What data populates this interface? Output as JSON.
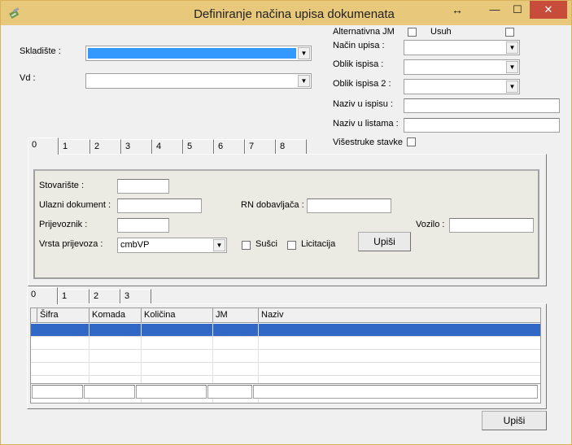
{
  "window": {
    "title": "Definiranje načina upisa dokumenata",
    "resize_glyph": "↔",
    "min_glyph": "—",
    "max_glyph": "☐",
    "close_glyph": "✕"
  },
  "form": {
    "skladiste_label": "Skladište :",
    "vd_label": "Vd :",
    "alternativna_jm_label": "Alternativna JM",
    "usuh_label": "Usuh",
    "nacin_upisa_label": "Način upisa :",
    "oblik_ispisa_label": "Oblik ispisa :",
    "oblik_ispisa2_label": "Oblik ispisa 2 :",
    "naziv_u_ispisu_label": "Naziv u ispisu :",
    "naziv_u_listama_label": "Naziv u listama :",
    "visestruke_stavke_label": "Višestruke stavke"
  },
  "top_tabs": [
    "0",
    "1",
    "2",
    "3",
    "4",
    "5",
    "6",
    "7",
    "8"
  ],
  "panel": {
    "stovariste_label": "Stovarište :",
    "ulazni_dokument_label": "Ulazni dokument :",
    "rn_dobavljaca_label": "RN dobavljača :",
    "prijevoznik_label": "Prijevoznik :",
    "vozilo_label": "Vozilo :",
    "vrsta_prijevoza_label": "Vrsta prijevoza :",
    "vrsta_prijevoza_value": "cmbVP",
    "susci_label": "Sušci",
    "licitacija_label": "Licitacija",
    "upisi_label": "Upiši"
  },
  "bottom_tabs": [
    "0",
    "1",
    "2",
    "3"
  ],
  "grid": {
    "columns": [
      "Šifra",
      "Komada",
      "Količina",
      "JM",
      "Naziv"
    ]
  },
  "footer": {
    "upisi_label": "Upiši"
  },
  "colors": {
    "titlebar": "#e8c87a",
    "close_button": "#c74d3a",
    "selection": "#3399ff",
    "grid_selection": "#3168c6"
  }
}
